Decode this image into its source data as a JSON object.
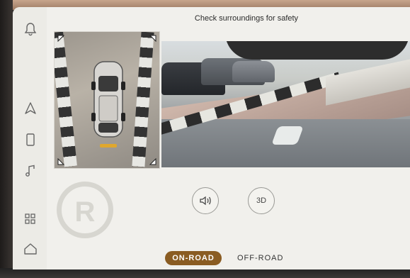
{
  "header": {
    "caption": "Check surroundings for safety"
  },
  "park_badge": {
    "letter": "R"
  },
  "controls": {
    "three_d_label": "3D"
  },
  "drive_modes": [
    {
      "label": "ON-ROAD",
      "selected": true
    },
    {
      "label": "OFF-ROAD",
      "selected": false
    }
  ],
  "sidebar": {
    "icons": [
      "bell-icon",
      "navigation-icon",
      "phone-icon",
      "music-icon",
      "apps-icon",
      "home-icon"
    ]
  },
  "colors": {
    "screen_bg": "#f1f0ec",
    "accent_selected": "#8a5c22",
    "text": "#2b2b2b"
  }
}
